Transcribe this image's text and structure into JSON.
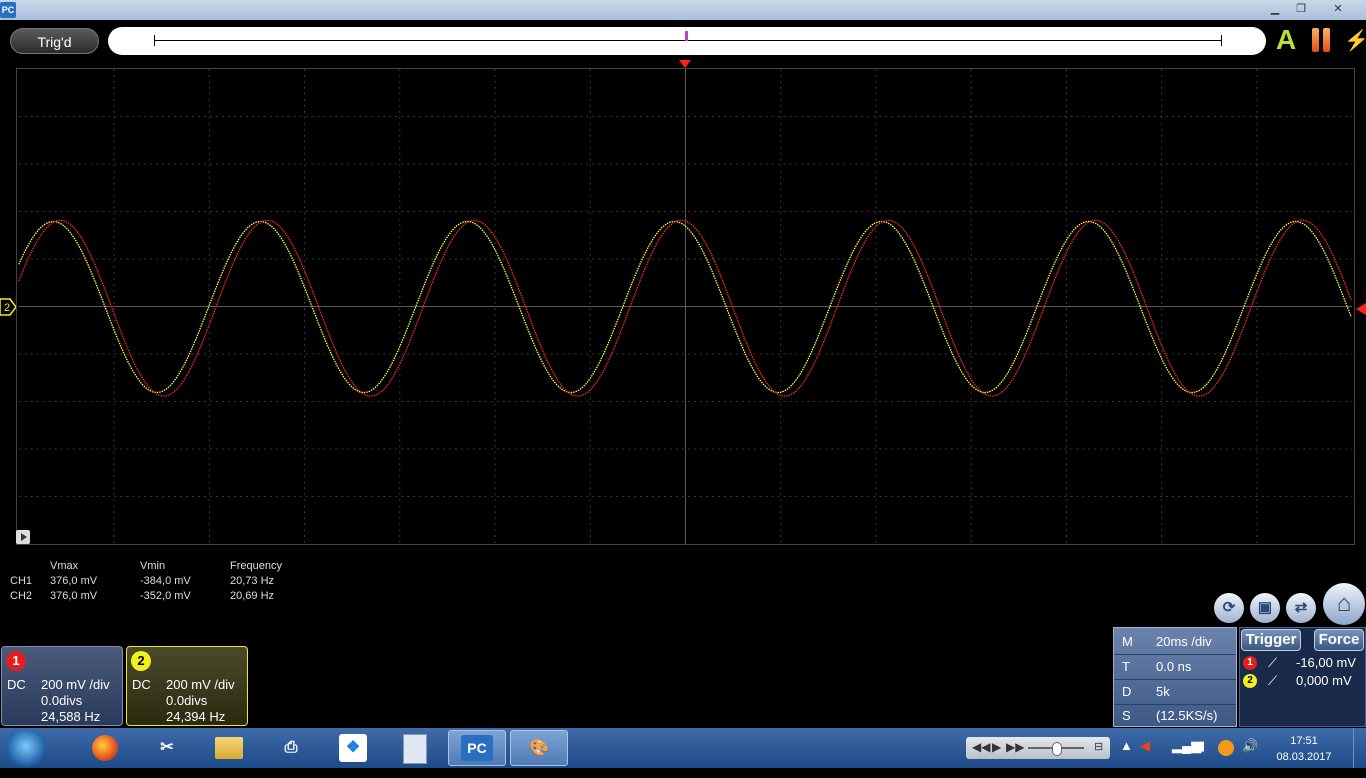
{
  "window": {
    "app_icon": "PC",
    "minimize": "▁",
    "restore": "❐",
    "close": "✕"
  },
  "topbar": {
    "trigger_status": "Trig'd",
    "auto_label": "A",
    "pause_icon": "pause-icon",
    "single_icon": "lightning-icon"
  },
  "scope": {
    "grid_divisions": {
      "x": 14,
      "y": 10
    },
    "ch2_marker": "2",
    "channel_colors": {
      "ch1": "#ff2a2a",
      "ch2": "#ffff33"
    }
  },
  "measurements": {
    "headers": [
      "Vmax",
      "Vmin",
      "Frequency"
    ],
    "rows": [
      {
        "channel": "CH1",
        "vmax": "376,0 mV",
        "vmin": "-384,0 mV",
        "frequency": "20,73 Hz"
      },
      {
        "channel": "CH2",
        "vmax": "376,0 mV",
        "vmin": "-352,0 mV",
        "frequency": "20,69 Hz"
      }
    ]
  },
  "channels": [
    {
      "number": "1",
      "coupling": "DC",
      "scale": "200 mV /div",
      "offset": "0.0divs",
      "freq": "24,588 Hz",
      "color": "#e02020"
    },
    {
      "number": "2",
      "coupling": "DC",
      "scale": "200 mV /div",
      "offset": "0.0divs",
      "freq": "24,394 Hz",
      "color": "#f0f020"
    }
  ],
  "timebase": {
    "M_label": "M",
    "M_value": "20ms /div",
    "T_label": "T",
    "T_value": "0.0 ns",
    "D_label": "D",
    "D_value": "5k",
    "S_label": "S",
    "S_value": "(12.5KS/s)"
  },
  "trigger": {
    "trigger_button": "Trigger",
    "force_button": "Force",
    "rows": [
      {
        "channel": "1",
        "value": "-16,00 mV"
      },
      {
        "channel": "2",
        "value": "0,000 mV"
      }
    ]
  },
  "toolbar_icons": [
    "refresh-icon",
    "save-icon",
    "display-settings-icon",
    "home-icon"
  ],
  "taskbar": {
    "apps": [
      "firefox-icon",
      "paint-tool-icon",
      "file-explorer-icon",
      "printer-icon",
      "dropbox-icon",
      "calculator-icon",
      "PC",
      "paint-icon"
    ],
    "clock_time": "17:51",
    "clock_date": "08.03.2017"
  }
}
